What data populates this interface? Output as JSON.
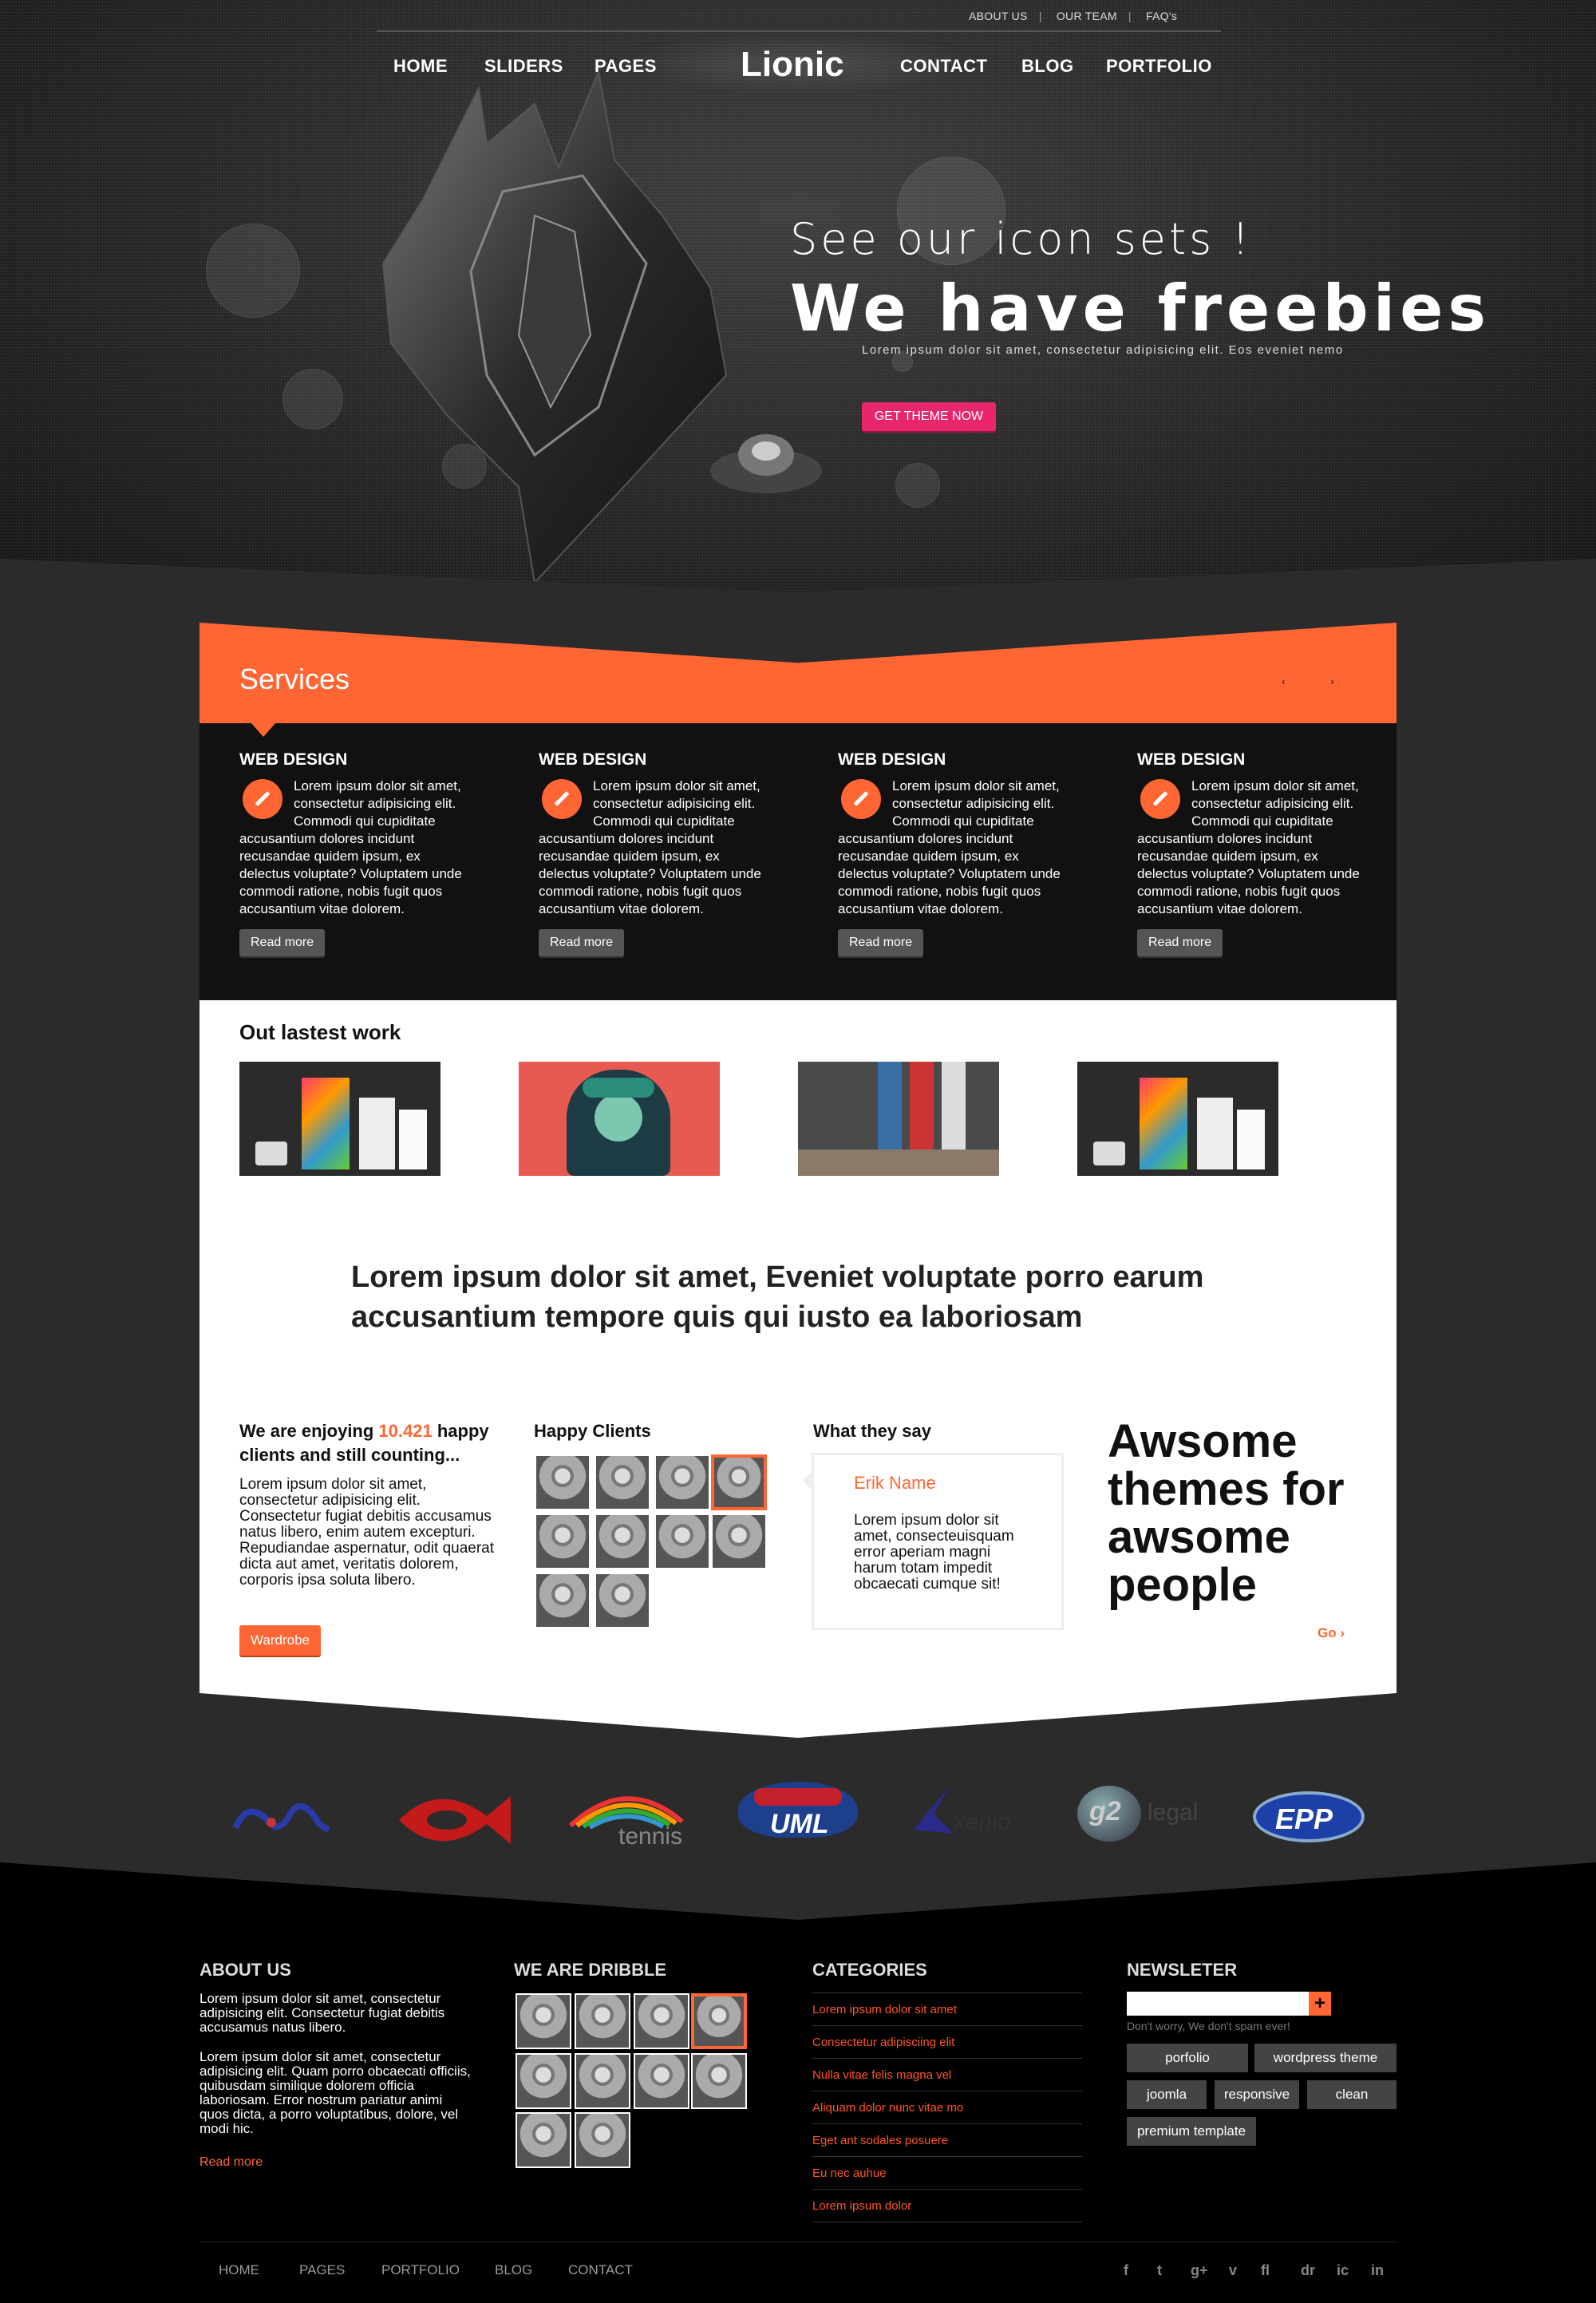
{
  "topbar": {
    "links": [
      "ABOUT US",
      "OUR TEAM",
      "FAQ's"
    ],
    "separator": "|"
  },
  "nav": {
    "left": [
      "HOME",
      "SLIDERS",
      "PAGES"
    ],
    "logo": "Lionic",
    "right": [
      "CONTACT",
      "BLOG",
      "PORTFOLIO"
    ]
  },
  "hero": {
    "subtitle": "See our icon sets !",
    "title": "We have freebies",
    "description": "Lorem ipsum dolor sit amet, consectetur adipisicing elit. Eos eveniet nemo",
    "button": "GET THEME NOW"
  },
  "services": {
    "title": "Services",
    "prev": "‹",
    "next": "›",
    "items": [
      {
        "title": "WEB DESIGN",
        "text": "Lorem ipsum dolor sit amet, consectetur adipisicing elit. Commodi qui cupiditate accusantium dolores incidunt recusandae quidem ipsum, ex delectus voluptate? Voluptatem unde commodi ratione, nobis fugit quos accusantium vitae dolorem.",
        "button": "Read more"
      },
      {
        "title": "WEB DESIGN",
        "text": "Lorem ipsum dolor sit amet, consectetur adipisicing elit. Commodi qui cupiditate accusantium dolores incidunt recusandae quidem ipsum, ex delectus voluptate? Voluptatem unde commodi ratione, nobis fugit quos accusantium vitae dolorem.",
        "button": "Read more"
      },
      {
        "title": "WEB DESIGN",
        "text": "Lorem ipsum dolor sit amet, consectetur adipisicing elit. Commodi qui cupiditate accusantium dolores incidunt recusandae quidem ipsum, ex delectus voluptate? Voluptatem unde commodi ratione, nobis fugit quos accusantium vitae dolorem.",
        "button": "Read more"
      },
      {
        "title": "WEB DESIGN",
        "text": "Lorem ipsum dolor sit amet, consectetur adipisicing elit. Commodi qui cupiditate accusantium dolores incidunt recusandae quidem ipsum, ex delectus voluptate? Voluptatem unde commodi ratione, nobis fugit quos accusantium vitae dolorem.",
        "button": "Read more"
      }
    ]
  },
  "latest_work": {
    "title": "Out lastest work"
  },
  "quote": "Lorem ipsum dolor sit amet, Eveniet voluptate porro earum accusantium tempore quis qui iusto ea laboriosam",
  "enjoying": {
    "prefix": "We are enjoying ",
    "count": "10.421",
    "suffix": " happy clients and still counting...",
    "text": "Lorem ipsum dolor sit amet, consectetur adipisicing elit. Consectetur fugiat debitis accusamus natus libero, enim autem excepturi. Repudiandae aspernatur, odit quaerat dicta aut amet, veritatis dolorem, corporis ipsa soluta libero.",
    "button": "Wardrobe"
  },
  "happy_clients": {
    "title": "Happy Clients"
  },
  "testimonial": {
    "title": "What they say",
    "name": "Erik Name",
    "text": "Lorem ipsum dolor sit amet, consecteuisquam error aperiam magni harum totam impedit obcaecati cumque sit!"
  },
  "promo": {
    "text": "Awsome themes for awsome people",
    "link": "Go ›"
  },
  "partner_logos": [
    "tennis",
    "UML",
    "xenio",
    "g2",
    "legal",
    "EPP"
  ],
  "footer": {
    "about": {
      "title": "ABOUT US",
      "text1": "Lorem ipsum dolor sit amet, consectetur adipisicing elit. Consectetur fugiat debitis accusamus natus libero.",
      "text2": "Lorem ipsum dolor sit amet, consectetur adipisicing elit. Quam porro obcaecati officiis, quibusdam similique dolorem officia laboriosam. Error nostrum pariatur animi quos dicta, a porro voluptatibus, dolore, vel modi hic.",
      "link": "Read more"
    },
    "dribble": {
      "title": "WE ARE DRIBBLE"
    },
    "categories": {
      "title": "CATEGORIES",
      "items": [
        "Lorem ipsum dolor sit amet",
        "Consectetur adipisciing elit",
        "Nulla vitae felis magna vel",
        "Aliquam dolor nunc vitae mo",
        "Eget ant sodales posuere",
        "Eu nec auhue",
        "Lorem ipsum dolor"
      ]
    },
    "newsletter": {
      "title": "NEWSLETER",
      "note": "Don't worry, We don't spam ever!",
      "plus": "+",
      "tags": [
        "porfolio",
        "wordpress theme",
        "joomla",
        "responsive",
        "clean",
        "premium template"
      ]
    },
    "nav": [
      "HOME",
      "PAGES",
      "PORTFOLIO",
      "BLOG",
      "CONTACT"
    ],
    "social": [
      "f",
      "t",
      "g+",
      "v",
      "fl",
      "dr",
      "ic",
      "in"
    ]
  },
  "colors": {
    "accent": "#ff6633",
    "hero_button": "#e8266c",
    "dark": "#111111"
  }
}
